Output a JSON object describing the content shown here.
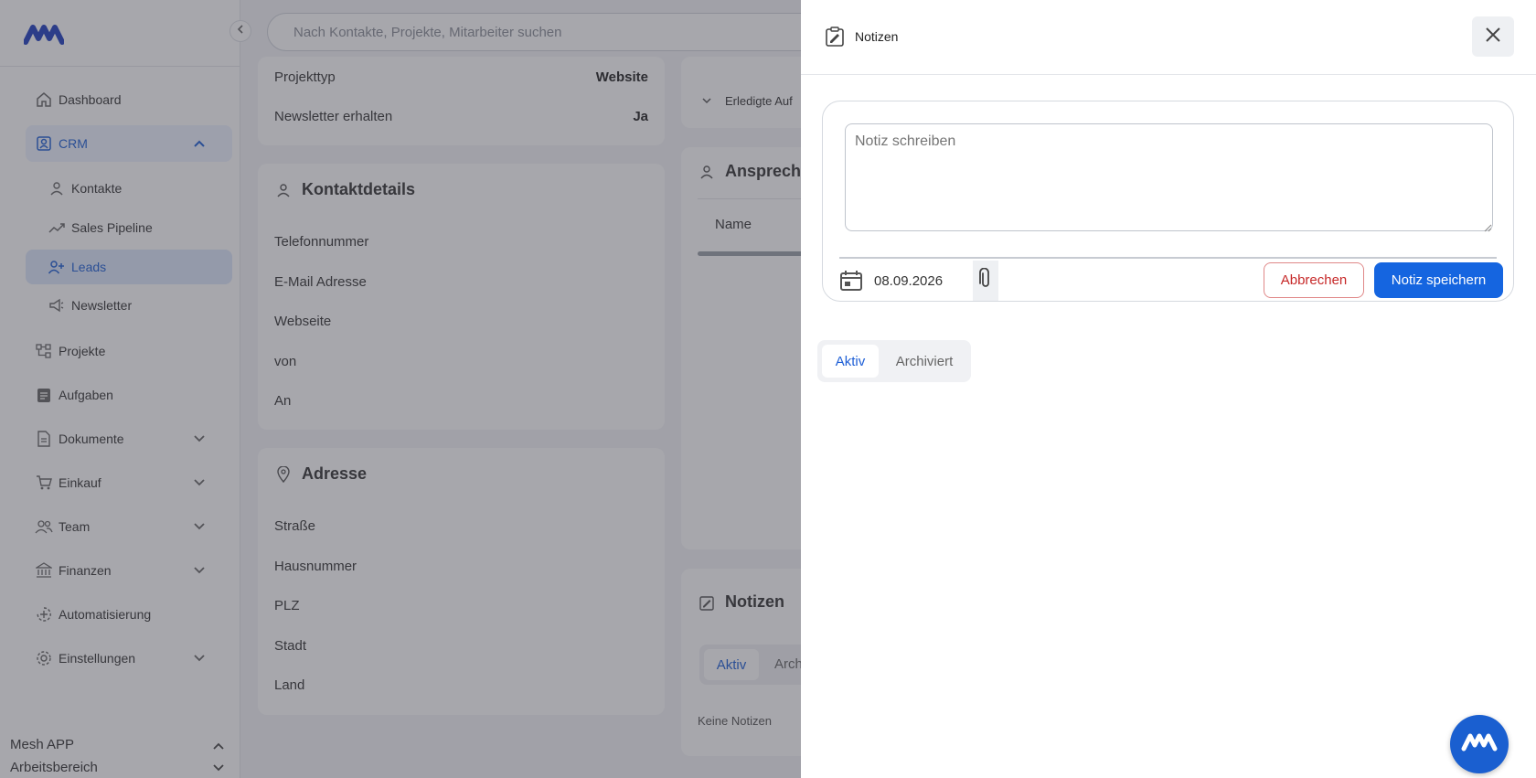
{
  "search": {
    "placeholder": "Nach Kontakte, Projekte, Mitarbeiter suchen"
  },
  "sidebar": {
    "items": {
      "dashboard": "Dashboard",
      "crm": "CRM",
      "kontakte": "Kontakte",
      "sales_pipeline": "Sales Pipeline",
      "leads": "Leads",
      "newsletter": "Newsletter",
      "projekte": "Projekte",
      "aufgaben": "Aufgaben",
      "dokumente": "Dokumente",
      "einkauf": "Einkauf",
      "team": "Team",
      "finanzen": "Finanzen",
      "automatisierung": "Automatisierung",
      "einstellungen": "Einstellungen"
    },
    "workspace": {
      "app": "Mesh APP",
      "area": "Arbeitsbereich"
    }
  },
  "main": {
    "project": {
      "projekttyp_label": "Projekttyp",
      "projekttyp_value": "Website",
      "newsletter_label": "Newsletter erhalten",
      "newsletter_value": "Ja"
    },
    "kontaktdetails": {
      "title": "Kontaktdetails",
      "fields": [
        "Telefonnummer",
        "E-Mail Adresse",
        "Webseite",
        "von",
        "An"
      ]
    },
    "adresse": {
      "title": "Adresse",
      "fields": [
        "Straße",
        "Hausnummer",
        "PLZ",
        "Stadt",
        "Land"
      ]
    },
    "tasks": {
      "done_label": "Erledigte Auf"
    },
    "ansprechpartner": {
      "title": "Ansprech",
      "name_col": "Name"
    },
    "notes_card": {
      "title": "Notizen",
      "tab_active": "Aktiv",
      "tab_archived": "Arch",
      "empty": "Keine Notizen"
    }
  },
  "drawer": {
    "title": "Notizen",
    "textarea_placeholder": "Notiz schreiben",
    "date": "08.09.2026",
    "cancel_label": "Abbrechen",
    "save_label": "Notiz speichern",
    "tabs": {
      "active": "Aktiv",
      "archived": "Archiviert"
    }
  },
  "colors": {
    "accent": "#1565e0",
    "danger": "#c62828",
    "active_nav_bg": "#dce7fb"
  },
  "icons": [
    "logo-icon",
    "chevron-left-icon",
    "home-icon",
    "crm-icon",
    "user-icon",
    "trend-icon",
    "user-plus-icon",
    "megaphone-icon",
    "projects-icon",
    "task-icon",
    "document-icon",
    "cart-icon",
    "team-icon",
    "bank-icon",
    "automation-icon",
    "gear-icon",
    "note-icon",
    "close-icon",
    "calendar-icon",
    "paperclip-icon",
    "pin-icon"
  ]
}
